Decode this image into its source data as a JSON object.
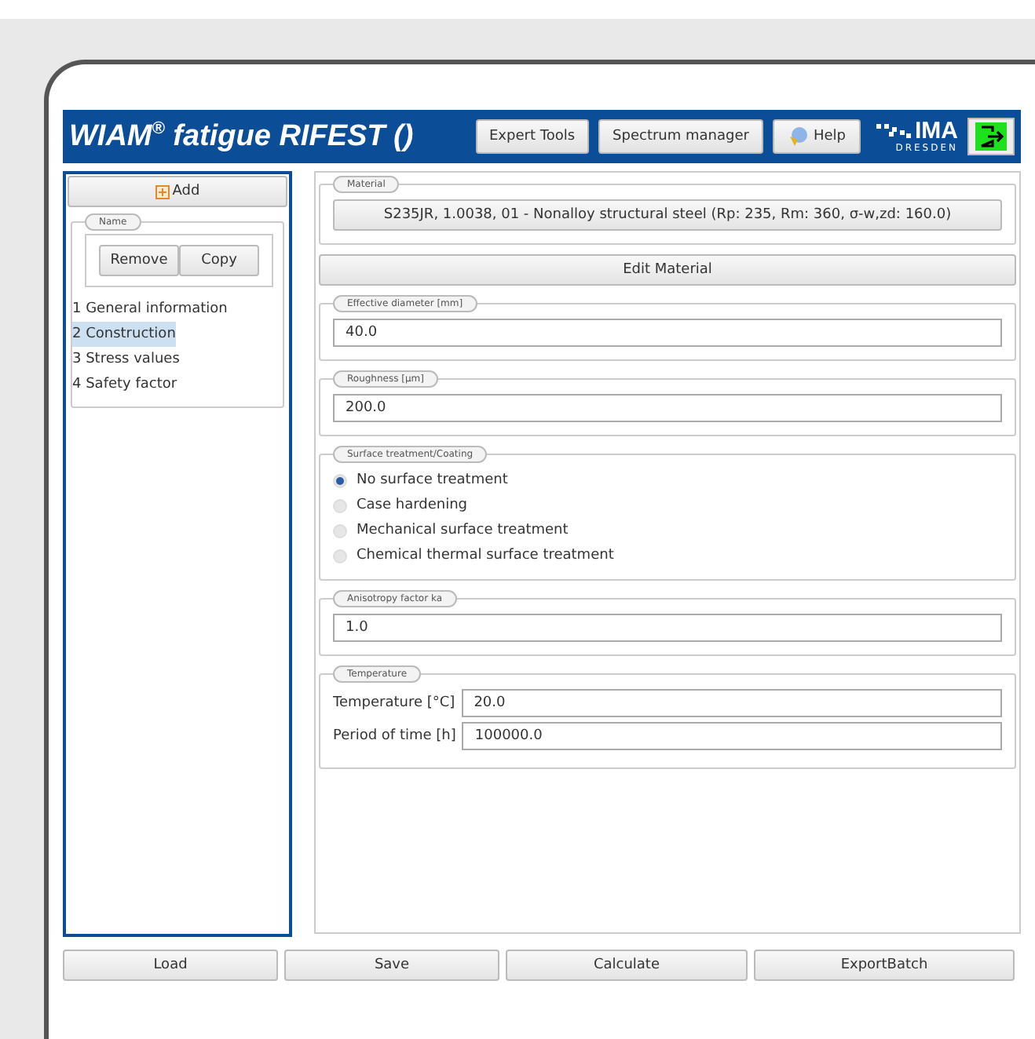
{
  "header": {
    "title": "WIAM$^{®}$ fatigue RIFEST ()",
    "buttons": [
      {
        "label": "Expert Tools",
        "kind": "text"
      },
      {
        "label": "Spectrum manager",
        "kind": "text"
      },
      {
        "label": "Help",
        "kind": "help"
      }
    ],
    "logo": {
      "name": "IMA",
      "subtitle": "DRESDEN"
    }
  },
  "sidebar": {
    "add_button": "Add",
    "group_label": "Name",
    "actions": [
      "Remove",
      "Copy"
    ],
    "items": [
      {
        "label": "1 General information",
        "selected": false
      },
      {
        "label": "2 Construction",
        "selected": true
      },
      {
        "label": "3 Stress values",
        "selected": false
      },
      {
        "label": "4 Safety factor",
        "selected": false
      }
    ]
  },
  "material": {
    "legend": "Material",
    "value": "S235JR, 1.0038, 01 - Nonalloy structural steel (Rp: 235, Rm: 360, σ-w,zd: 160.0)",
    "edit_button": "Edit Material"
  },
  "sections": [
    {
      "kind": "field",
      "legend": "Effective diameter [mm]",
      "value": "40.0"
    },
    {
      "kind": "field",
      "legend": "Roughness [µm]",
      "value": "200.0"
    },
    {
      "kind": "radio",
      "legend": "Surface treatment/Coating",
      "options": [
        {
          "label": "No surface treatment",
          "selected": true
        },
        {
          "label": "Case hardening",
          "selected": false
        },
        {
          "label": "Mechanical surface treatment",
          "selected": false
        },
        {
          "label": "Chemical thermal surface treatment",
          "selected": false
        }
      ]
    },
    {
      "kind": "field",
      "legend": "Anisotropy factor ka",
      "value": "1.0"
    },
    {
      "kind": "labeled",
      "legend": "Temperature",
      "rows": [
        {
          "label": "Temperature [°C]",
          "value": "20.0"
        },
        {
          "label": "Period of time [h]",
          "value": "100000.0"
        }
      ]
    }
  ],
  "footer_buttons": [
    "Load",
    "Save",
    "Calculate",
    "ExportBatch"
  ]
}
